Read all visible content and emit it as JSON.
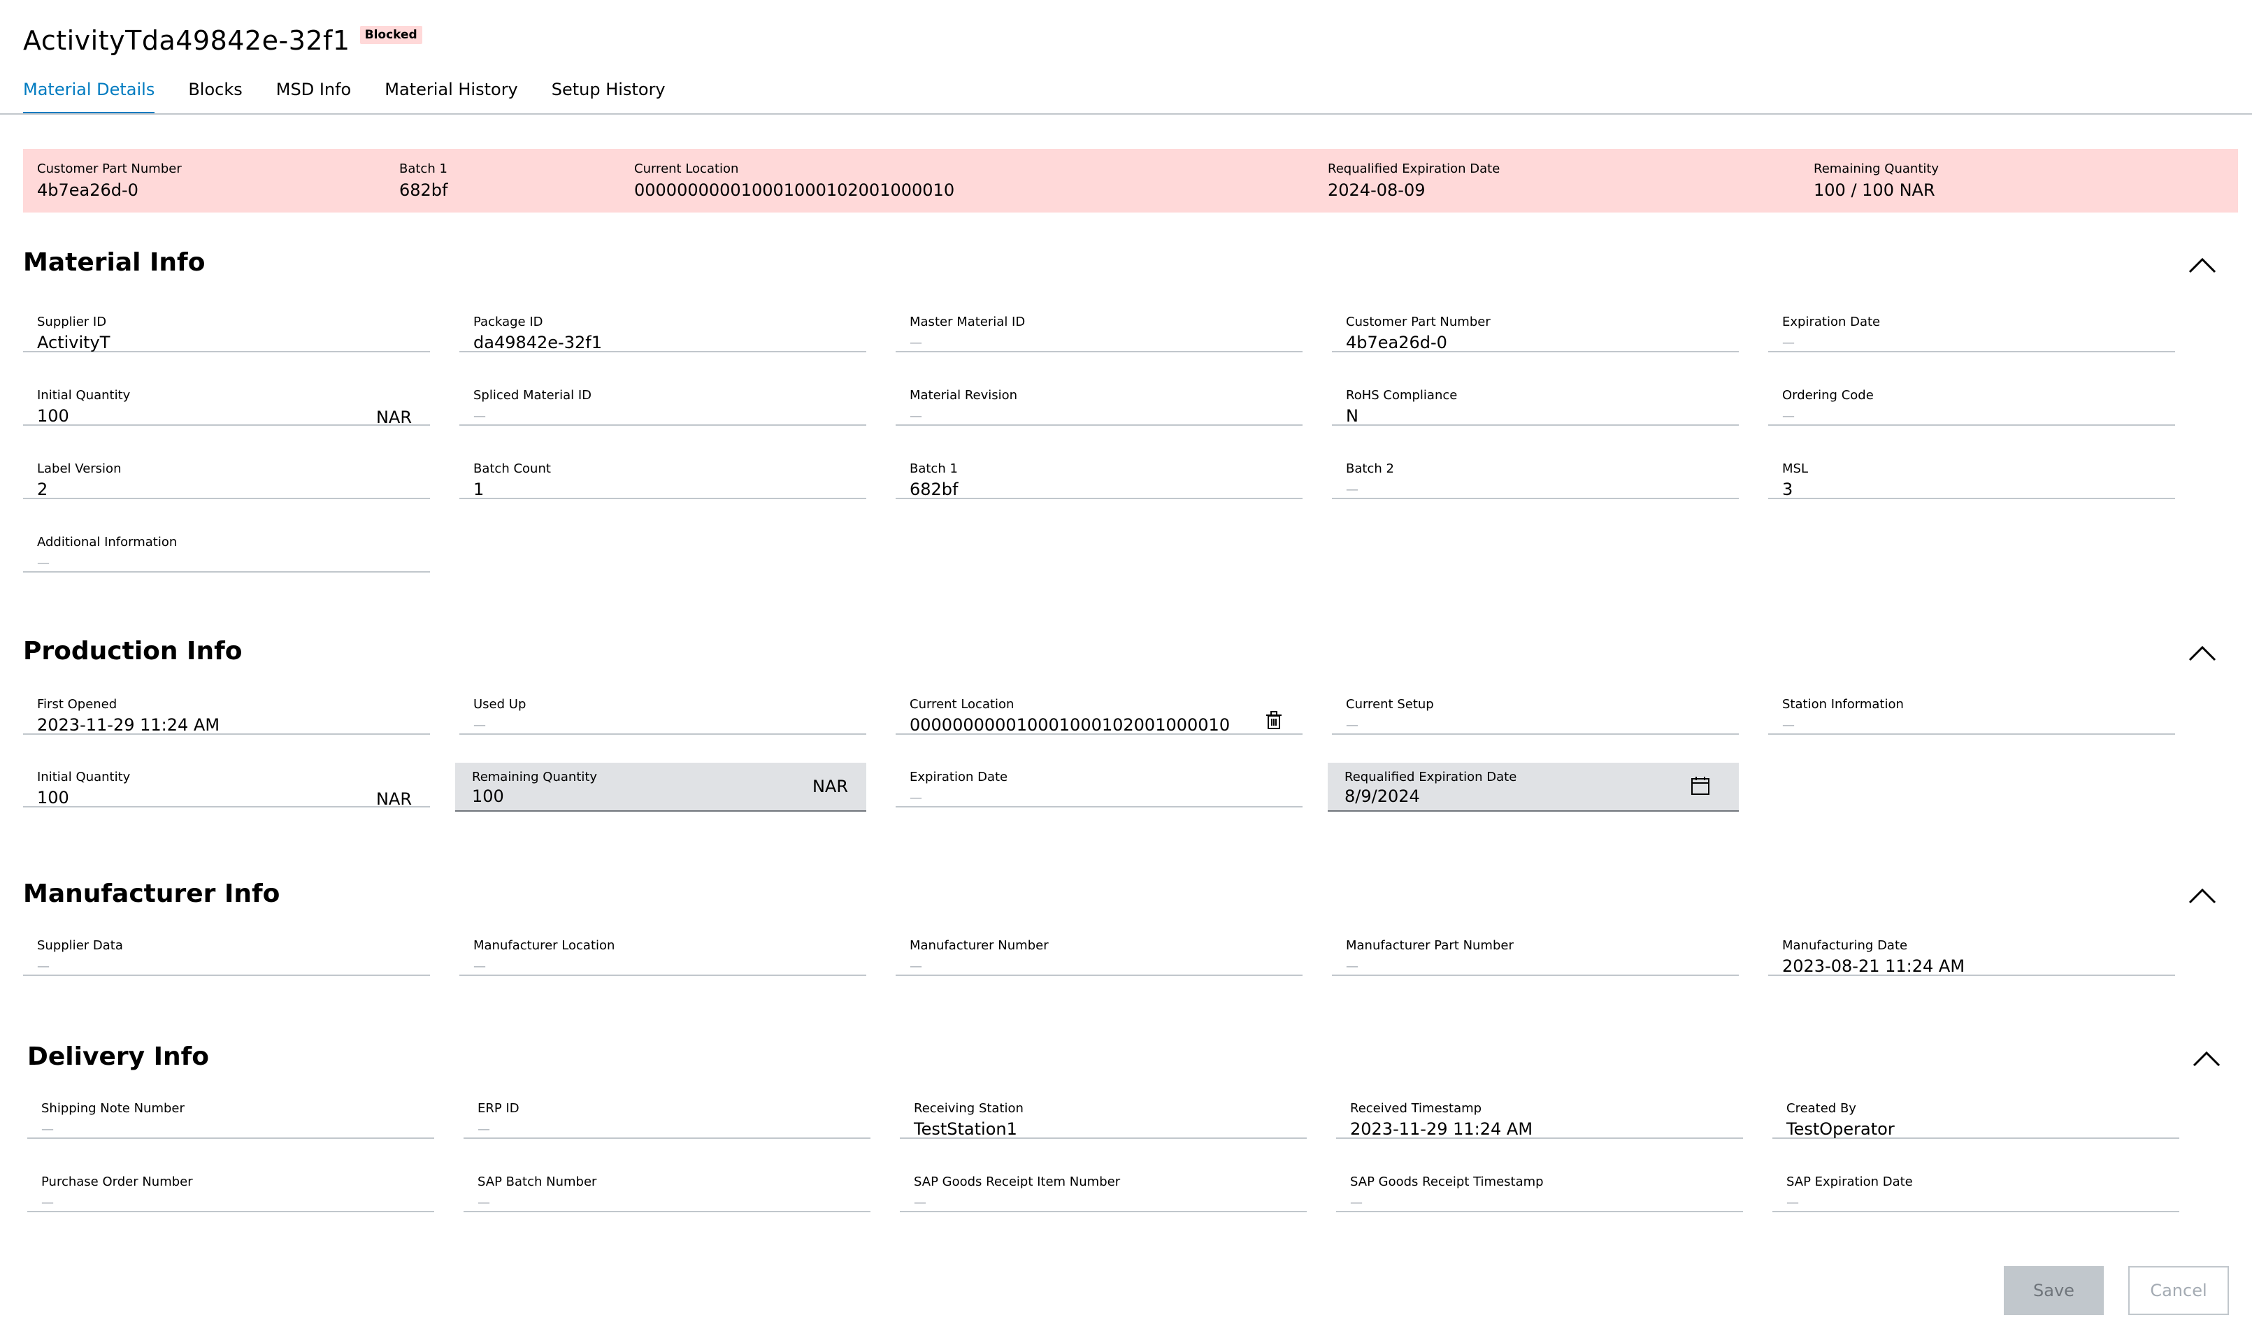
{
  "header": {
    "title": "ActivityTda49842e-32f1",
    "status": "Blocked"
  },
  "tabs": [
    {
      "label": "Material Details",
      "active": true
    },
    {
      "label": "Blocks"
    },
    {
      "label": "MSD Info"
    },
    {
      "label": "Material History"
    },
    {
      "label": "Setup History"
    }
  ],
  "summary": {
    "customer_part_number": {
      "label": "Customer Part Number",
      "value": "4b7ea26d-0"
    },
    "batch1": {
      "label": "Batch 1",
      "value": "682bf"
    },
    "current_location": {
      "label": "Current Location",
      "value": "000000000010001000102001000010"
    },
    "requalified_expiration": {
      "label": "Requalified Expiration Date",
      "value": "2024-08-09"
    },
    "remaining_quantity": {
      "label": "Remaining Quantity",
      "value": "100 / 100 NAR"
    }
  },
  "empty_value": "—",
  "material_info": {
    "title": "Material Info",
    "supplier_id": {
      "label": "Supplier ID",
      "value": "ActivityT"
    },
    "package_id": {
      "label": "Package ID",
      "value": "da49842e-32f1"
    },
    "master_material_id": {
      "label": "Master Material ID"
    },
    "customer_part_number": {
      "label": "Customer Part Number",
      "value": "4b7ea26d-0"
    },
    "expiration_date": {
      "label": "Expiration Date"
    },
    "initial_quantity": {
      "label": "Initial Quantity",
      "value": "100",
      "unit": "NAR"
    },
    "spliced_material_id": {
      "label": "Spliced Material ID"
    },
    "material_revision": {
      "label": "Material Revision"
    },
    "rohs_compliance": {
      "label": "RoHS Compliance",
      "value": "N"
    },
    "ordering_code": {
      "label": "Ordering Code"
    },
    "label_version": {
      "label": "Label Version",
      "value": "2"
    },
    "batch_count": {
      "label": "Batch Count",
      "value": "1"
    },
    "batch1": {
      "label": "Batch 1",
      "value": "682bf"
    },
    "batch2": {
      "label": "Batch 2"
    },
    "msl": {
      "label": "MSL",
      "value": "3"
    },
    "additional_information": {
      "label": "Additional Information"
    }
  },
  "production_info": {
    "title": "Production Info",
    "first_opened": {
      "label": "First Opened",
      "value": "2023-11-29 11:24 AM"
    },
    "used_up": {
      "label": "Used Up"
    },
    "current_location": {
      "label": "Current Location",
      "value": "000000000010001000102001000010"
    },
    "current_setup": {
      "label": "Current Setup"
    },
    "station_information": {
      "label": "Station Information"
    },
    "initial_quantity": {
      "label": "Initial Quantity",
      "value": "100",
      "unit": "NAR"
    },
    "remaining_quantity": {
      "label": "Remaining Quantity",
      "value": "100",
      "unit": "NAR"
    },
    "expiration_date": {
      "label": "Expiration Date"
    },
    "requalified_expiration": {
      "label": "Requalified Expiration Date",
      "value": "8/9/2024"
    }
  },
  "manufacturer_info": {
    "title": "Manufacturer Info",
    "supplier_data": {
      "label": "Supplier Data"
    },
    "manufacturer_location": {
      "label": "Manufacturer Location"
    },
    "manufacturer_number": {
      "label": "Manufacturer Number"
    },
    "manufacturer_part_number": {
      "label": "Manufacturer Part Number"
    },
    "manufacturing_date": {
      "label": "Manufacturing Date",
      "value": "2023-08-21 11:24 AM"
    }
  },
  "delivery_info": {
    "title": "Delivery Info",
    "shipping_note_number": {
      "label": "Shipping Note Number"
    },
    "erp_id": {
      "label": "ERP ID"
    },
    "receiving_station": {
      "label": "Receiving Station",
      "value": "TestStation1"
    },
    "received_timestamp": {
      "label": "Received Timestamp",
      "value": "2023-11-29 11:24 AM"
    },
    "created_by": {
      "label": "Created By",
      "value": "TestOperator"
    },
    "purchase_order_number": {
      "label": "Purchase Order Number"
    },
    "sap_batch_number": {
      "label": "SAP Batch Number"
    },
    "sap_goods_receipt_item_number": {
      "label": "SAP Goods Receipt Item Number"
    },
    "sap_goods_receipt_timestamp": {
      "label": "SAP Goods Receipt Timestamp"
    },
    "sap_expiration_date": {
      "label": "SAP Expiration Date"
    }
  },
  "actions": {
    "save": "Save",
    "cancel": "Cancel"
  },
  "icons": {
    "collapse": "chevron-up-icon",
    "delete": "trash-icon",
    "calendar": "calendar-icon"
  },
  "colors": {
    "accent": "#007bc0",
    "blocked_bg": "#ffd9d9"
  }
}
